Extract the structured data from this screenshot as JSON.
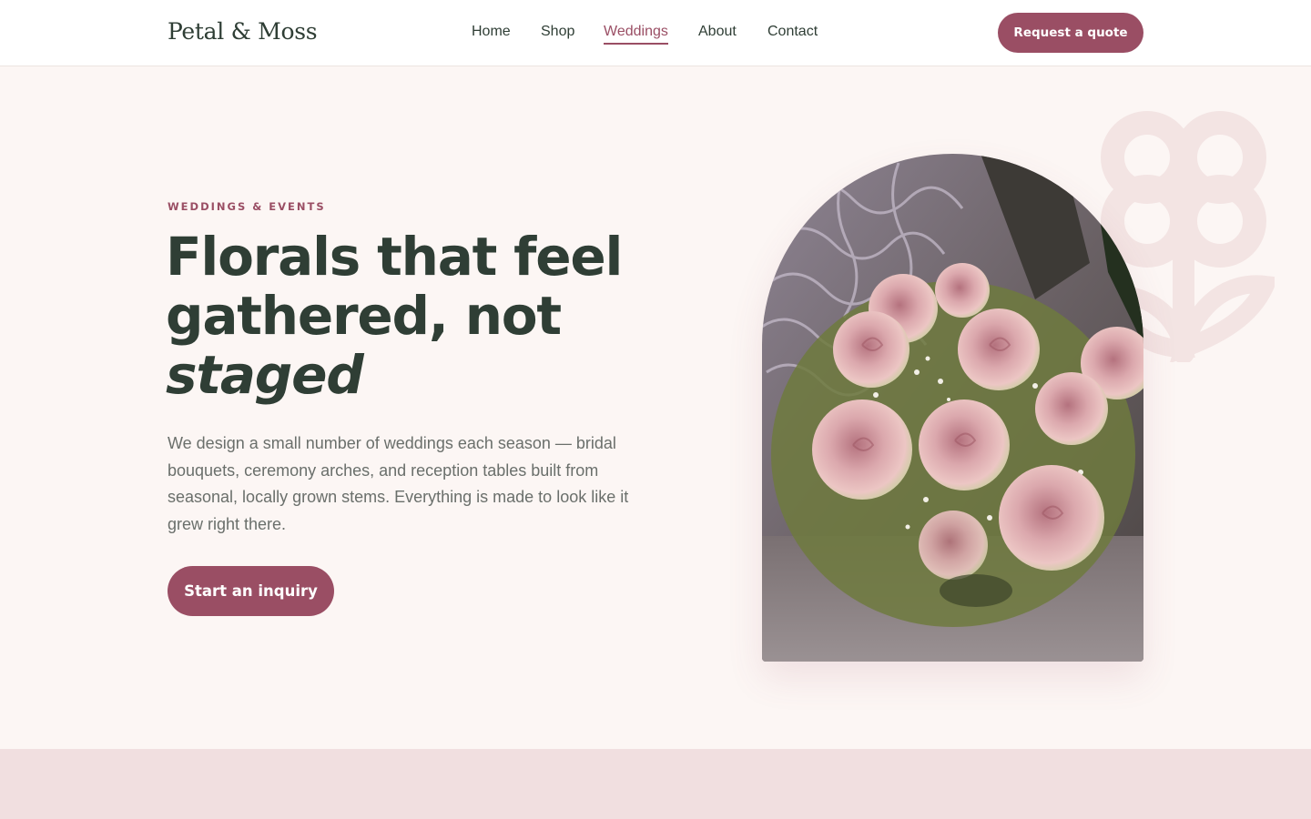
{
  "header": {
    "logo": "Petal & Moss",
    "nav": [
      {
        "label": "Home",
        "active": false
      },
      {
        "label": "Shop",
        "active": false
      },
      {
        "label": "Weddings",
        "active": true
      },
      {
        "label": "About",
        "active": false
      },
      {
        "label": "Contact",
        "active": false
      }
    ],
    "quote_button": "Request a quote"
  },
  "hero": {
    "eyebrow": "WEDDINGS & EVENTS",
    "headline_line1": "Florals that feel",
    "headline_line2": "gathered, not",
    "headline_line3": "staged",
    "lede": "We design a small number of weddings each season — bridal bouquets, ceremony arches, and reception tables built from seasonal, locally grown stems. Everything is made to look like it grew right there.",
    "cta": "Start an inquiry"
  },
  "colors": {
    "accent": "#9a4e64",
    "text_dark": "#2f3e35",
    "page_bg": "#fcf6f4",
    "band_bg": "#f1dfe0"
  },
  "icons": {
    "decoration": "flower-outline-icon"
  }
}
